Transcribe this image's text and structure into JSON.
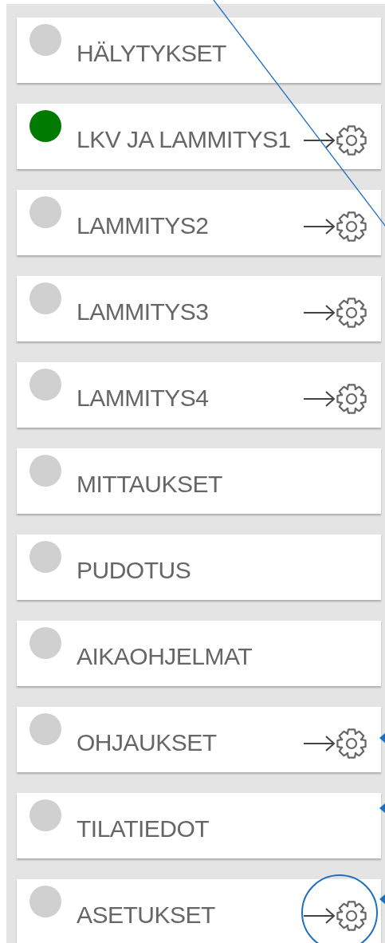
{
  "menu": {
    "items": [
      {
        "label": "HÄLYTYKSET",
        "color": "#d0d0d0",
        "settings": false,
        "pointer": false,
        "circled": false
      },
      {
        "label": "LKV JA LAMMITYS1",
        "color": "#007a00",
        "settings": true,
        "pointer": false,
        "circled": false
      },
      {
        "label": "LAMMITYS2",
        "color": "#d0d0d0",
        "settings": true,
        "pointer": false,
        "circled": false
      },
      {
        "label": "LAMMITYS3",
        "color": "#d0d0d0",
        "settings": true,
        "pointer": false,
        "circled": false
      },
      {
        "label": "LAMMITYS4",
        "color": "#d0d0d0",
        "settings": true,
        "pointer": false,
        "circled": false
      },
      {
        "label": "MITTAUKSET",
        "color": "#d0d0d0",
        "settings": false,
        "pointer": false,
        "circled": false
      },
      {
        "label": "PUDOTUS",
        "color": "#d0d0d0",
        "settings": false,
        "pointer": false,
        "circled": false
      },
      {
        "label": "AIKAOHJELMAT",
        "color": "#d0d0d0",
        "settings": false,
        "pointer": false,
        "circled": false
      },
      {
        "label": "OHJAUKSET",
        "color": "#d0d0d0",
        "settings": true,
        "pointer": true,
        "circled": false
      },
      {
        "label": "TILATIEDOT",
        "color": "#d0d0d0",
        "settings": false,
        "pointer": true,
        "circled": false
      },
      {
        "label": "ASETUKSET",
        "color": "#d0d0d0",
        "settings": true,
        "pointer": true,
        "circled": true
      }
    ]
  }
}
